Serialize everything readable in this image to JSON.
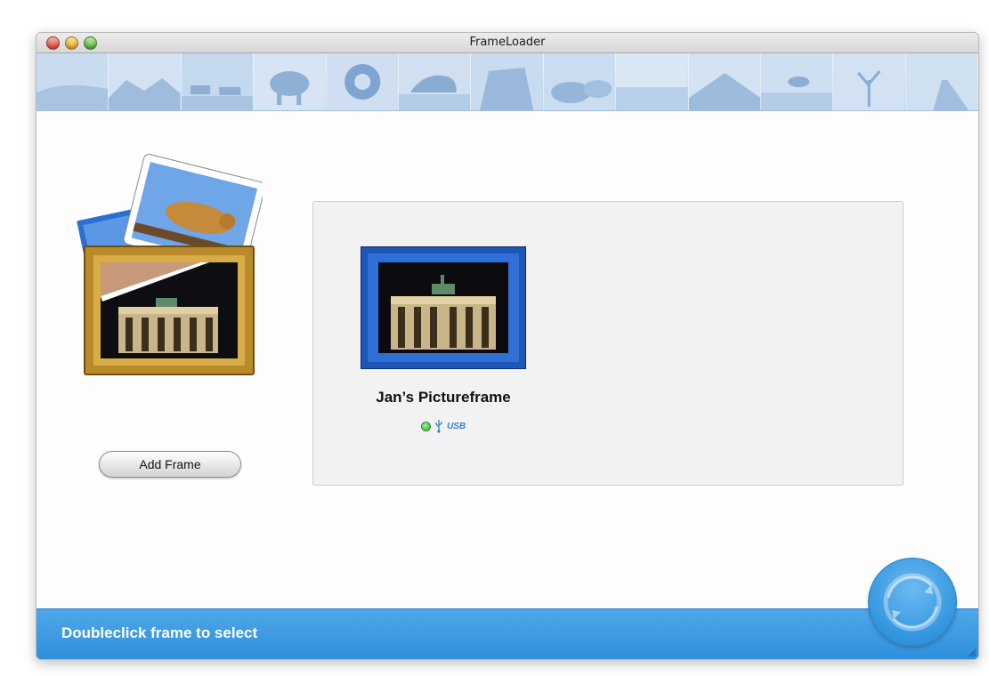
{
  "window": {
    "title": "FrameLoader"
  },
  "banner": {
    "tiles": [
      "desert-dunes",
      "rock-hills",
      "jeeps",
      "elephant",
      "tire-sculpture",
      "lioness",
      "rock-arch",
      "boulders",
      "sea",
      "mountain",
      "antelope",
      "tree",
      "road"
    ]
  },
  "sidebar": {
    "add_frame_label": "Add Frame"
  },
  "frames": [
    {
      "name": "Jan’s Pictureframe",
      "connection": "USB",
      "status_color": "#3cc54a"
    }
  ],
  "statusbar": {
    "text": "Doubleclick frame to select"
  },
  "colors": {
    "accent": "#3597e0",
    "banner": "#b6cde6"
  }
}
